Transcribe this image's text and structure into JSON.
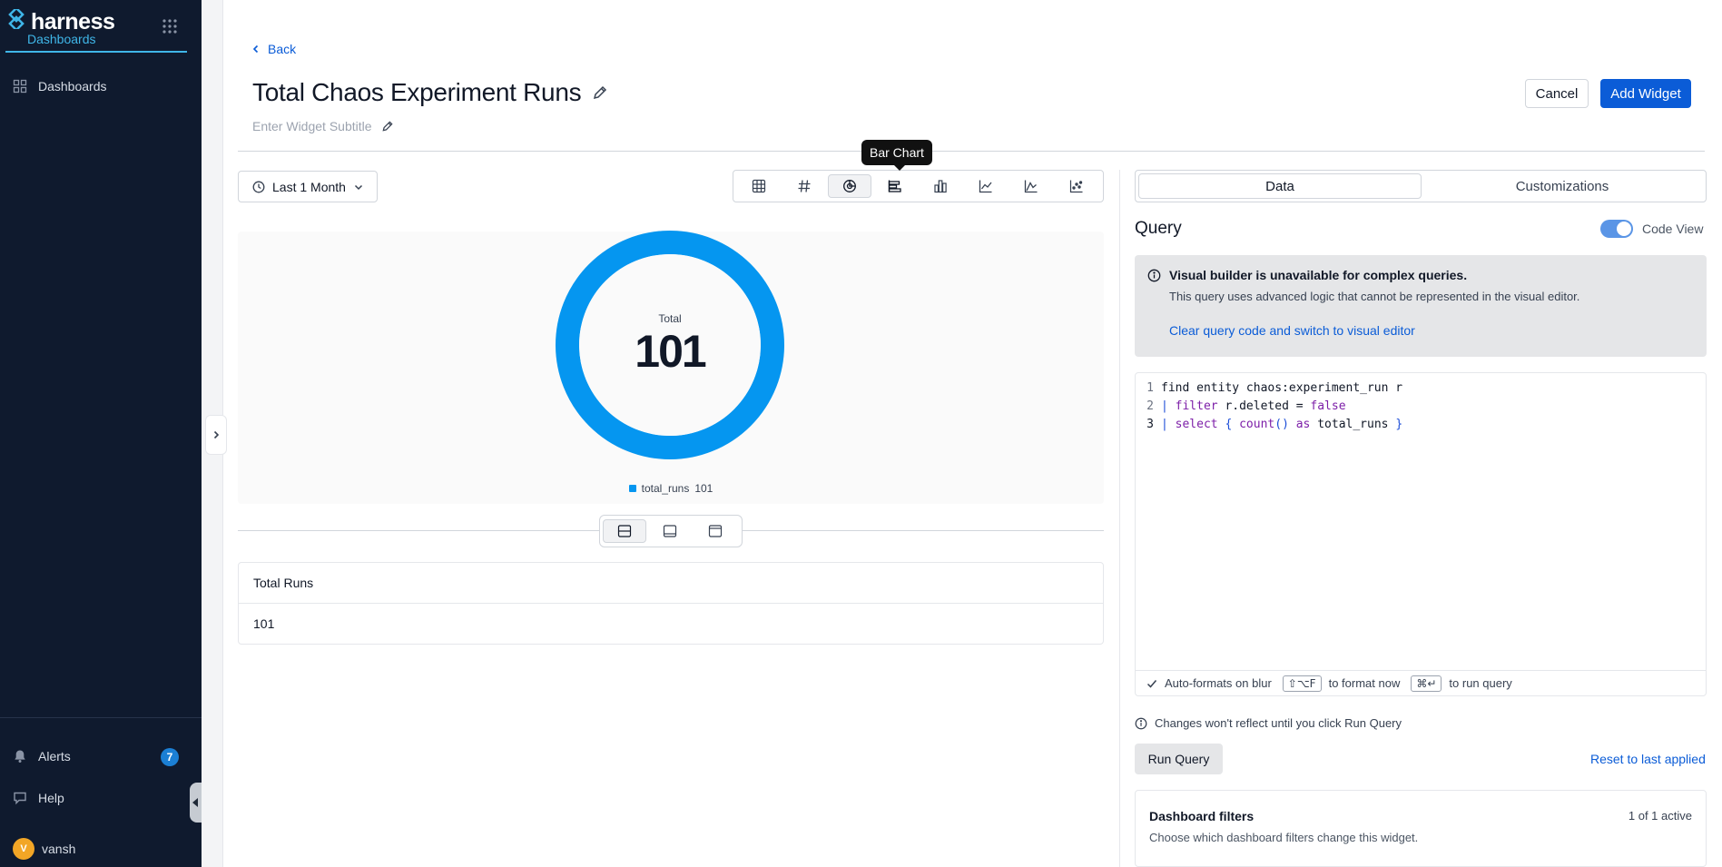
{
  "sidebar": {
    "brand": {
      "name": "harness",
      "module": "Dashboards"
    },
    "nav": [
      {
        "label": "Dashboards",
        "icon": "dashboard-grid-icon"
      }
    ],
    "bottom": {
      "alerts": {
        "label": "Alerts",
        "count": "7"
      },
      "help": {
        "label": "Help"
      },
      "user": {
        "name": "vansh",
        "initial": "V"
      }
    }
  },
  "header": {
    "back_label": "Back",
    "title": "Total Chaos Experiment Runs",
    "subtitle_placeholder": "Enter Widget Subtitle",
    "cancel_label": "Cancel",
    "add_label": "Add Widget"
  },
  "controls": {
    "time_range": "Last 1 Month",
    "chart_types": [
      {
        "name": "table",
        "icon": "table-icon"
      },
      {
        "name": "number",
        "icon": "hash-icon"
      },
      {
        "name": "pie",
        "icon": "pie-chart-icon",
        "active": true
      },
      {
        "name": "horizontal-bar",
        "icon": "horizontal-bar-chart-icon",
        "hovered": true
      },
      {
        "name": "bar",
        "icon": "bar-chart-icon"
      },
      {
        "name": "line",
        "icon": "line-chart-icon"
      },
      {
        "name": "area",
        "icon": "area-chart-icon"
      },
      {
        "name": "scatter",
        "icon": "scatter-chart-icon"
      }
    ],
    "tooltip": "Bar Chart"
  },
  "chart_data": {
    "type": "pie",
    "variant": "donut",
    "center_label": "Total",
    "center_value": "101",
    "slices": [
      {
        "name": "total_runs",
        "value": 101,
        "color": "#0596f0"
      }
    ],
    "legend_position": "bottom"
  },
  "result_table": {
    "columns": [
      "Total Runs"
    ],
    "rows": [
      [
        "101"
      ]
    ]
  },
  "right_panel": {
    "tabs": [
      {
        "label": "Data",
        "active": true
      },
      {
        "label": "Customizations",
        "active": false
      }
    ],
    "query_heading": "Query",
    "code_view_label": "Code View",
    "code_view_on": true,
    "notice": {
      "title": "Visual builder is unavailable for complex queries.",
      "description": "This query uses advanced logic that cannot be represented in the visual editor.",
      "link": "Clear query code and switch to visual editor"
    },
    "code_lines": [
      "find entity chaos:experiment_run r",
      "| filter r.deleted = false",
      "| select { count() as total_runs }"
    ],
    "editor_footer": {
      "autoformat": "Auto-formats on blur",
      "format_key": "⇧⌥F",
      "format_text": "to format now",
      "run_key": "⌘↵",
      "run_text": "to run query"
    },
    "changes_note": "Changes won't reflect until you click Run Query",
    "run_label": "Run Query",
    "reset_label": "Reset to last applied",
    "filters": {
      "title": "Dashboard filters",
      "count": "1 of 1 active",
      "description": "Choose which dashboard filters change this widget."
    }
  },
  "colors": {
    "accent": "#0b5cd7",
    "sidebar_bg": "#0f1a2e",
    "brand_teal": "#3fb6e8",
    "donut": "#0596f0"
  }
}
